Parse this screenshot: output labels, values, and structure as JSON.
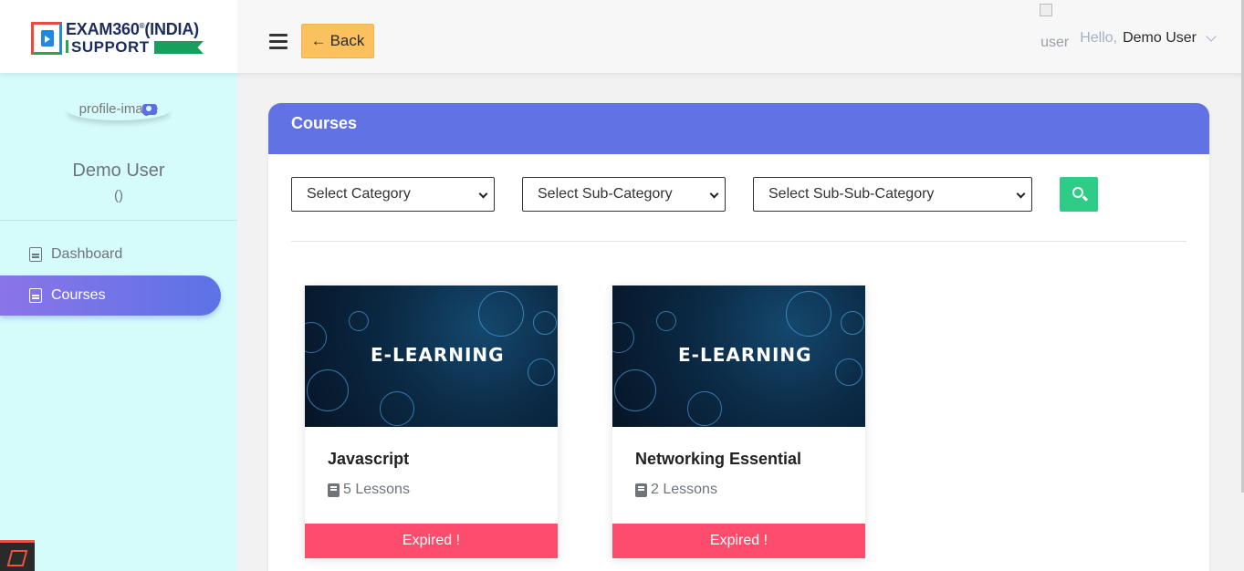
{
  "logo": {
    "line1": "EXAM360",
    "reg": "®",
    "line1b": "(INDIA)",
    "line2": "SUPPORT"
  },
  "header": {
    "back_label": "Back",
    "back_icon": "arrow-left-icon",
    "user_img_alt": "user",
    "hello": "Hello,",
    "user_name": "Demo User"
  },
  "sidebar": {
    "profile_img_alt": "profile-image",
    "name": "Demo User",
    "sub": "()",
    "items": [
      {
        "label": "Dashboard",
        "icon": "document-icon",
        "active": false
      },
      {
        "label": "Courses",
        "icon": "document-icon",
        "active": true
      }
    ]
  },
  "main": {
    "title": "Courses",
    "filters": {
      "category": "Select Category",
      "sub_category": "Select Sub-Category",
      "sub_sub_category": "Select Sub-Sub-Category"
    },
    "courses": [
      {
        "image_text": "E-LEARNING",
        "title": "Javascript",
        "lessons": "5 Lessons",
        "status": "Expired !"
      },
      {
        "image_text": "E-LEARNING",
        "title": "Networking Essential",
        "lessons": "2 Lessons",
        "status": "Expired !"
      }
    ]
  },
  "colors": {
    "accent": "#6072e4",
    "back_button": "#fcc15f",
    "search_button": "#2ecc87",
    "expired": "#fe4d6c",
    "sidebar_bg": "#d5fbfb"
  }
}
